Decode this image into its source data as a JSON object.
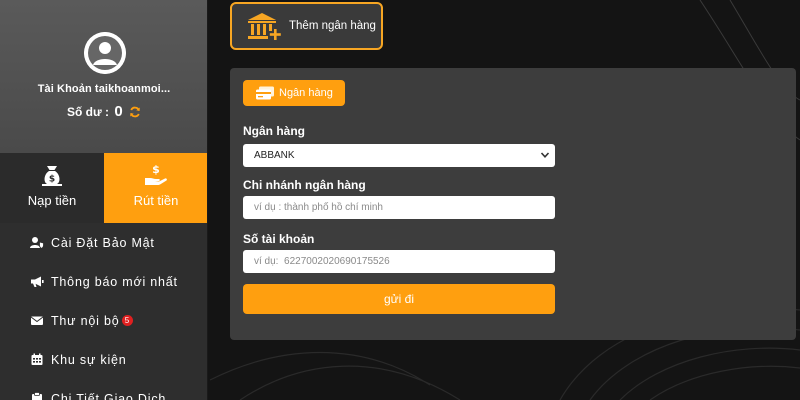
{
  "colors": {
    "accent": "#ff9f0f",
    "border_accent": "#f7a623",
    "badge": "#e02020"
  },
  "sidebar": {
    "account_name": "Tài Khoản taikhoanmoi...",
    "balance_label": "Số dư :",
    "balance_value": "0",
    "deposit_label": "Nạp tiền",
    "withdraw_label": "Rút tiền",
    "menu": [
      {
        "label": "Cài Đặt Bảo Mật",
        "icon": "user-shield-icon"
      },
      {
        "label": "Thông báo mới nhất",
        "icon": "megaphone-icon"
      },
      {
        "label": "Thư nội bộ",
        "icon": "envelope-icon",
        "badge": "5"
      },
      {
        "label": "Khu sự kiện",
        "icon": "calendar-icon"
      },
      {
        "label": "Chi Tiết Giao Dịch",
        "icon": "clipboard-icon"
      }
    ]
  },
  "main": {
    "add_bank_label": "Thêm ngân hàng",
    "bank_tab_label": "Ngân hàng",
    "form": {
      "bank_label": "Ngân hàng",
      "bank_selected": "ABBANK",
      "branch_label": "Chi nhánh ngân hàng",
      "branch_placeholder": "ví dụ : thành phố hồ chí minh",
      "account_label": "Số tài khoản",
      "account_placeholder": "ví dụ:  6227002020690175526",
      "submit_label": "gửi đi"
    }
  }
}
